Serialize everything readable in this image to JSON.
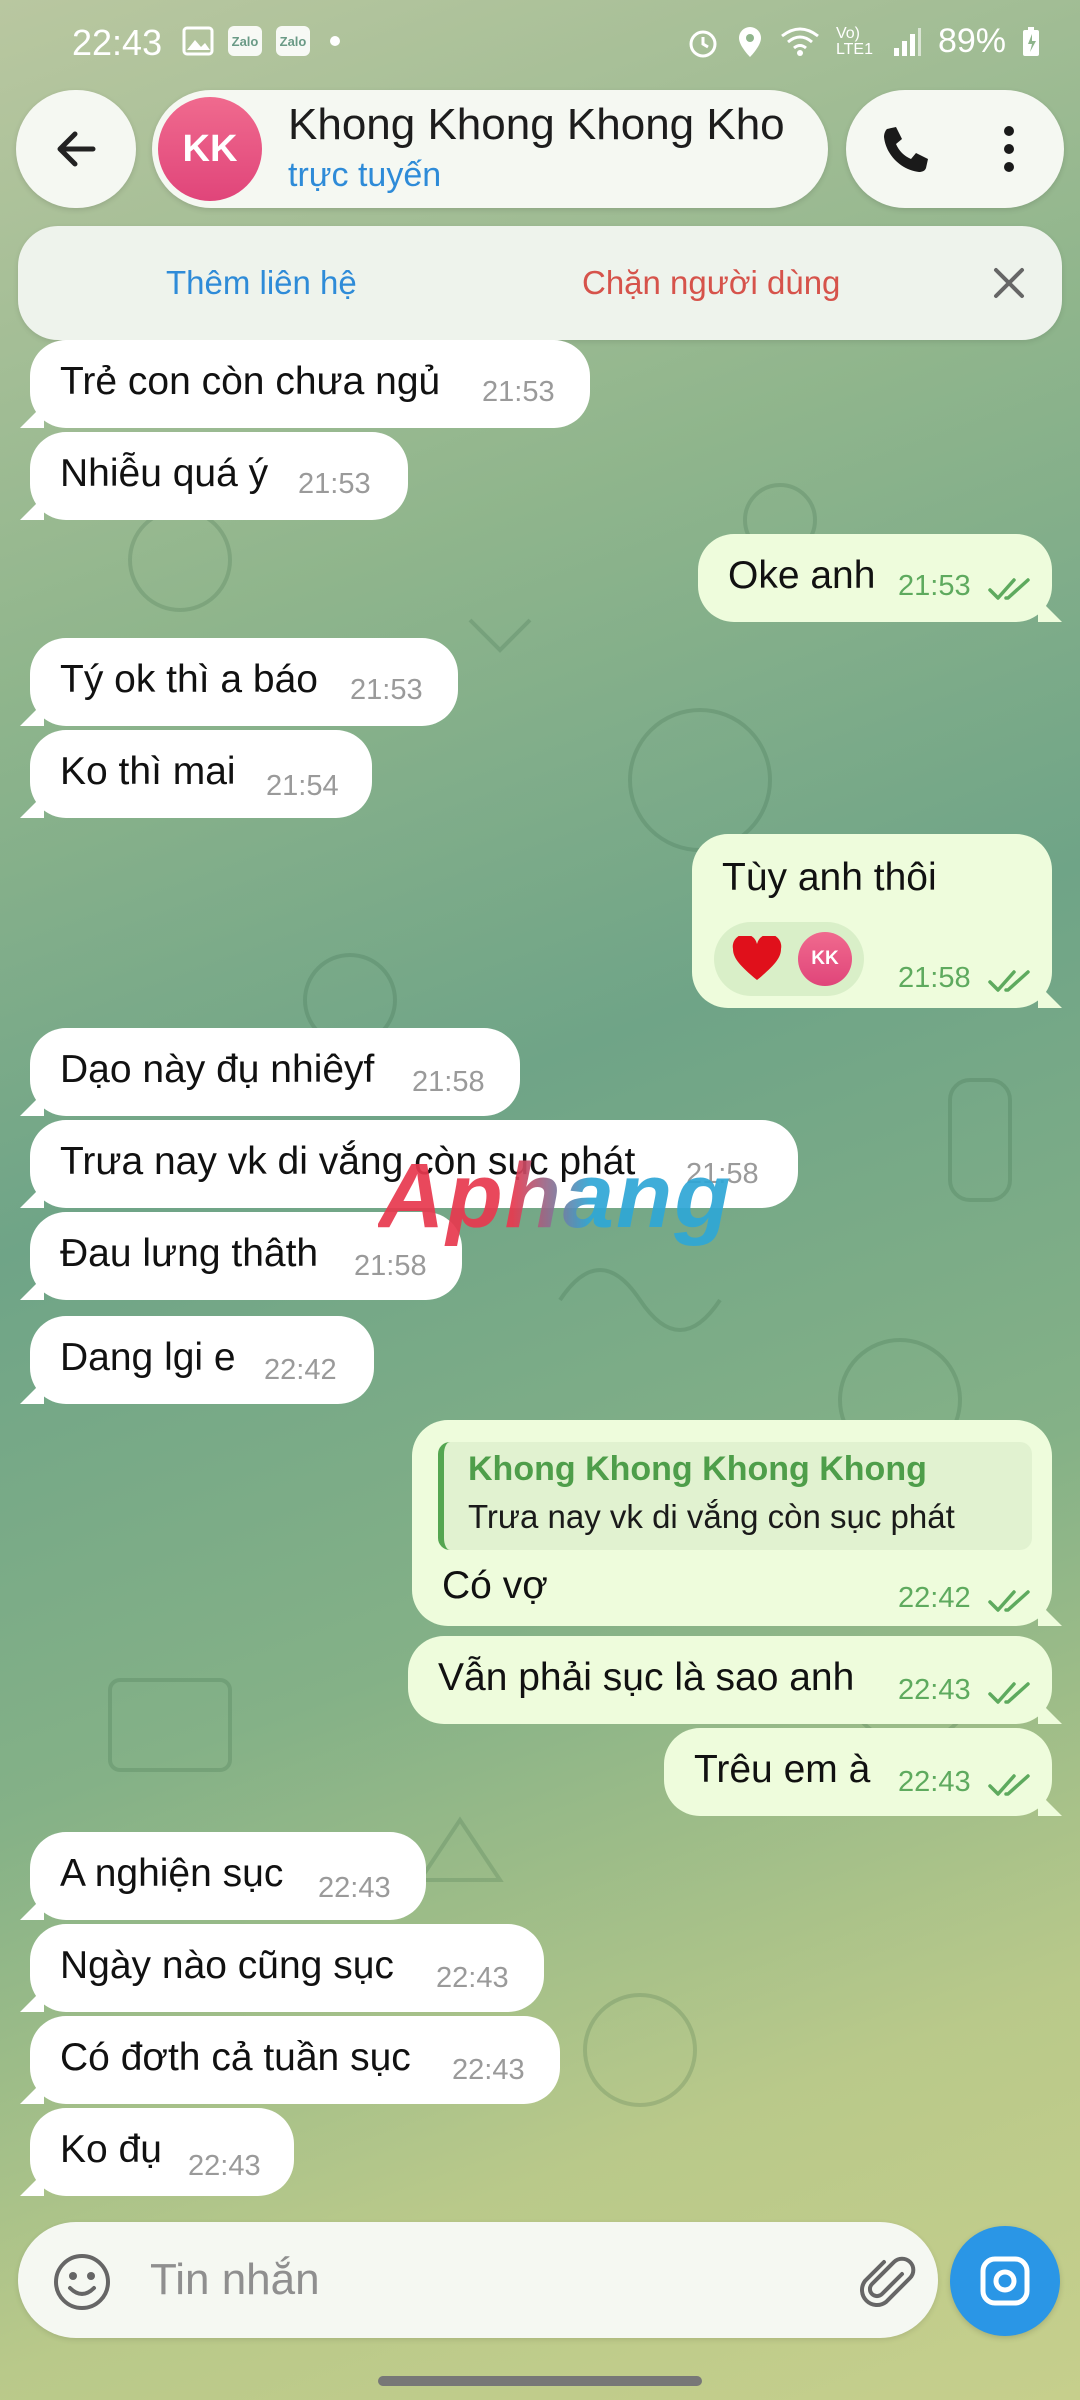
{
  "status_bar": {
    "time": "22:43",
    "left_mini_icons": [
      "Zalo",
      "Zalo"
    ],
    "battery": "89%",
    "network_label": "Vo) LTE1"
  },
  "header": {
    "avatar_initials": "KK",
    "contact_name": "Khong Khong Khong Kho",
    "status": "trực tuyến"
  },
  "action_bar": {
    "add_contact": "Thêm liên hệ",
    "block_user": "Chặn người dùng"
  },
  "messages": [
    {
      "dir": "in",
      "text": "Trẻ con còn chưa ngủ",
      "time": "21:53"
    },
    {
      "dir": "in",
      "text": "Nhiễu quá ý",
      "time": "21:53"
    },
    {
      "dir": "out",
      "text": "Oke anh",
      "time": "21:53"
    },
    {
      "dir": "in",
      "text": "Tý ok thì a báo",
      "time": "21:53"
    },
    {
      "dir": "in",
      "text": "Ko thì mai",
      "time": "21:54"
    },
    {
      "dir": "out",
      "text": "Tùy anh thôi",
      "time": "21:58",
      "reaction": {
        "emoji": "heart",
        "avatar": "KK"
      }
    },
    {
      "dir": "in",
      "text": "Dạo này đụ nhiêyf",
      "time": "21:58"
    },
    {
      "dir": "in",
      "text": "Trưa nay vk di vắng còn sục phát",
      "time": "21:58"
    },
    {
      "dir": "in",
      "text": "Đau lưng thâth",
      "time": "21:58"
    },
    {
      "dir": "in",
      "text": "Dang lgi e",
      "time": "22:42"
    },
    {
      "dir": "out",
      "text": "Có vợ",
      "time": "22:42",
      "reply": {
        "name": "Khong Khong Khong Khong",
        "text": "Trưa nay vk di vắng còn sục phát"
      }
    },
    {
      "dir": "out",
      "text": "Vẫn phải sục là sao anh",
      "time": "22:43"
    },
    {
      "dir": "out",
      "text": "Trêu em à",
      "time": "22:43"
    },
    {
      "dir": "in",
      "text": "A nghiện sục",
      "time": "22:43"
    },
    {
      "dir": "in",
      "text": "Ngày nào cũng sục",
      "time": "22:43"
    },
    {
      "dir": "in",
      "text": "Có đơth cả tuần sục",
      "time": "22:43"
    },
    {
      "dir": "in",
      "text": "Ko đụ",
      "time": "22:43"
    }
  ],
  "watermark": "Aphang",
  "input": {
    "placeholder": "Tin nhắn",
    "value": ""
  },
  "colors": {
    "accent_blue": "#2e8bd8",
    "block_red": "#d6534b",
    "outgoing_bubble": "#eefcdc",
    "incoming_bubble": "#ffffff",
    "read_check_green": "#5eaa5e",
    "camera_button": "#2a96e6"
  },
  "icons": {
    "back": "arrow-left-icon",
    "call": "phone-icon",
    "more": "more-vertical-icon",
    "close": "close-icon",
    "emoji": "smile-icon",
    "attach": "paperclip-icon",
    "camera": "camera-icon"
  }
}
